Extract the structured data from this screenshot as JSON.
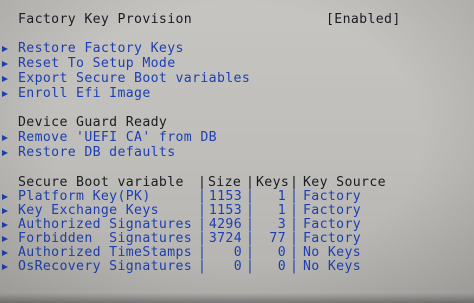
{
  "header": {
    "title": "Factory Key Provision",
    "value": "[Enabled]"
  },
  "menu": {
    "restore_factory_keys": "Restore Factory Keys",
    "reset_setup_mode": "Reset To Setup Mode",
    "export_secure_boot": "Export Secure Boot variables",
    "enroll_efi_image": "Enroll Efi Image"
  },
  "device_guard": {
    "heading": "Device Guard Ready",
    "remove_uefi_ca": "Remove 'UEFI CA' from DB",
    "restore_db_defaults": "Restore DB defaults"
  },
  "table": {
    "headers": {
      "variable": "Secure Boot variable",
      "size": "Size",
      "keys": "Keys",
      "source": "Key Source"
    },
    "rows": [
      {
        "variable": "Platform Key(PK)",
        "size": "1153",
        "keys": "1",
        "source": "Factory"
      },
      {
        "variable": "Key Exchange Keys",
        "size": "1153",
        "keys": "1",
        "source": "Factory"
      },
      {
        "variable": "Authorized Signatures",
        "size": "4296",
        "keys": "3",
        "source": "Factory"
      },
      {
        "variable": "Forbidden  Signatures",
        "size": "3724",
        "keys": "77",
        "source": "Factory"
      },
      {
        "variable": "Authorized TimeStamps",
        "size": "0",
        "keys": "0",
        "source": "No Keys"
      },
      {
        "variable": "OsRecovery Signatures",
        "size": "0",
        "keys": "0",
        "source": "No Keys"
      }
    ]
  },
  "colors": {
    "selectable_text": "#1d3fb2",
    "static_text": "#1b1b22",
    "background": "#c2c1bd"
  }
}
